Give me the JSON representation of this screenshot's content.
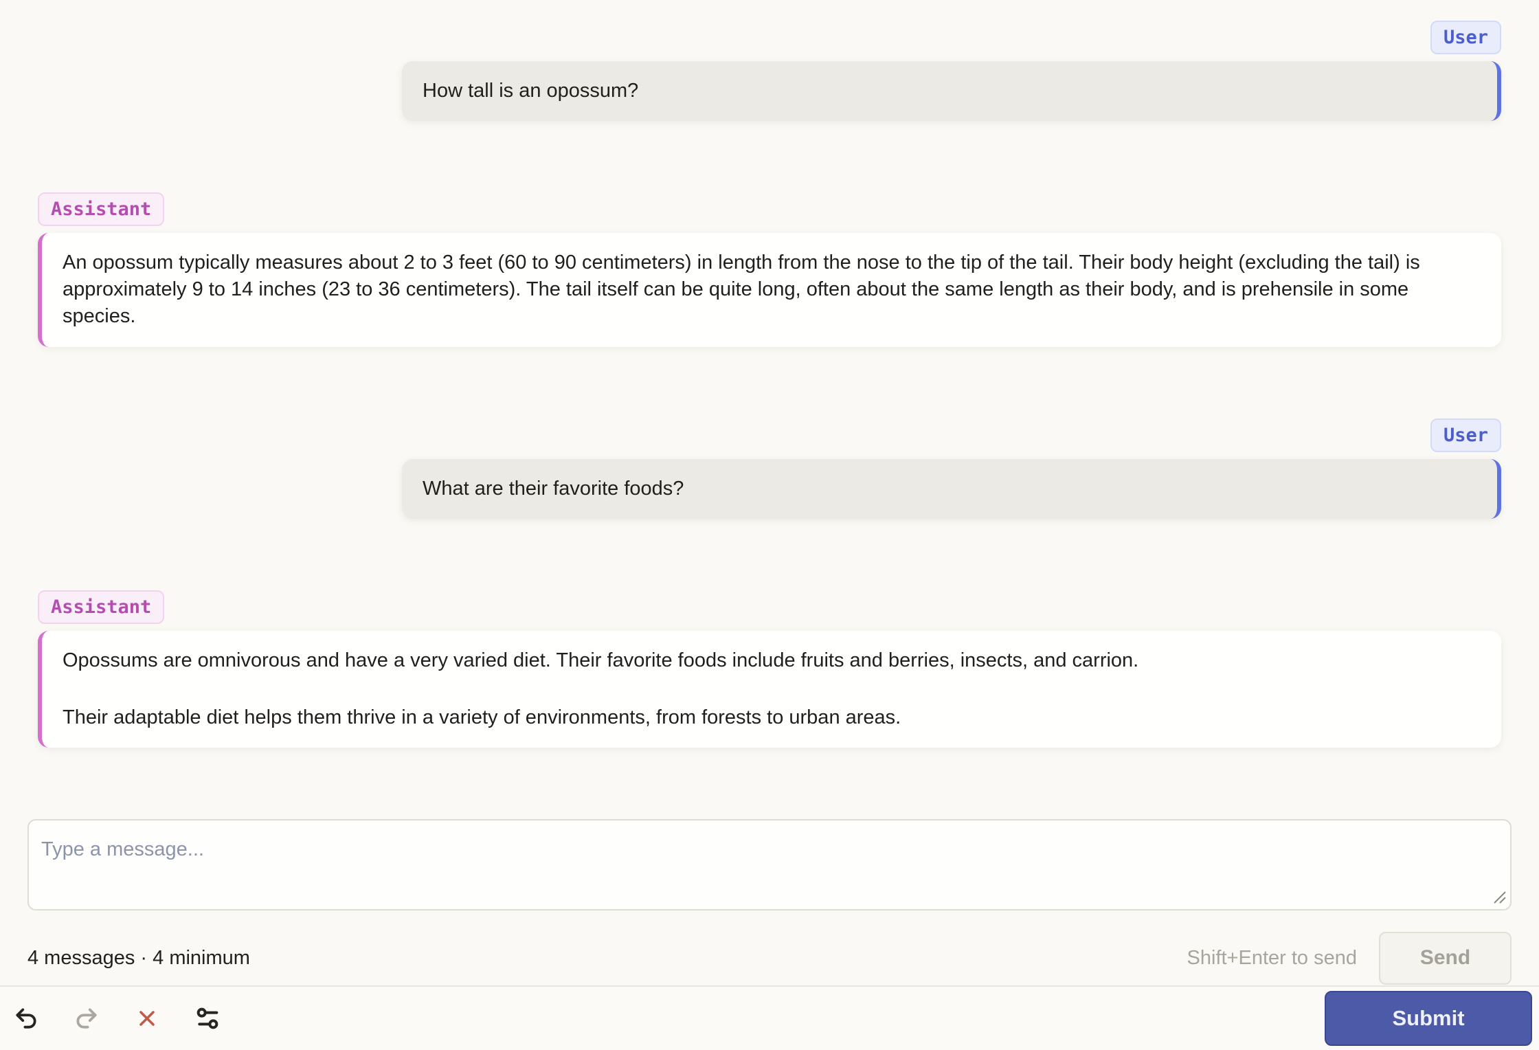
{
  "conversation": {
    "messages": [
      {
        "role_label": "User",
        "paragraphs": [
          "How tall is an opossum?"
        ]
      },
      {
        "role_label": "Assistant",
        "paragraphs": [
          "An opossum typically measures about 2 to 3 feet (60 to 90 centimeters) in length from the nose to the tip of the tail. Their body height (excluding the tail) is approximately 9 to 14 inches (23 to 36 centimeters). The tail itself can be quite long, often about the same length as their body, and is prehensile in some species."
        ]
      },
      {
        "role_label": "User",
        "paragraphs": [
          "What are their favorite foods?"
        ]
      },
      {
        "role_label": "Assistant",
        "paragraphs": [
          "Opossums are omnivorous and have a very varied diet. Their favorite foods include fruits and berries, insects, and carrion.",
          "Their adaptable diet helps them thrive in a variety of environments, from forests to urban areas."
        ]
      }
    ]
  },
  "composer": {
    "placeholder": "Type a message...",
    "status": "4 messages · 4 minimum",
    "hint": "Shift+Enter to send",
    "send_label": "Send"
  },
  "toolbar": {
    "icons": [
      "undo-icon",
      "redo-icon",
      "close-icon",
      "settings-sliders-icon"
    ],
    "submit_label": "Submit"
  },
  "colors": {
    "page_bg": "#FAF9F5",
    "user_accent": "#5E72E4",
    "user_badge_text": "#4C5EC9",
    "user_badge_bg": "#E9ECFB",
    "assistant_accent": "#D46FD0",
    "assistant_badge_text": "#B44DB1",
    "assistant_badge_bg": "#FAEEF9",
    "user_bubble_bg": "#ECEAE5",
    "assistant_bubble_bg": "#FFFFFE",
    "submit_bg": "#4C5AA7",
    "delete_icon": "#C05B49",
    "disabled_icon": "#ABA79E",
    "active_icon": "#262521"
  }
}
